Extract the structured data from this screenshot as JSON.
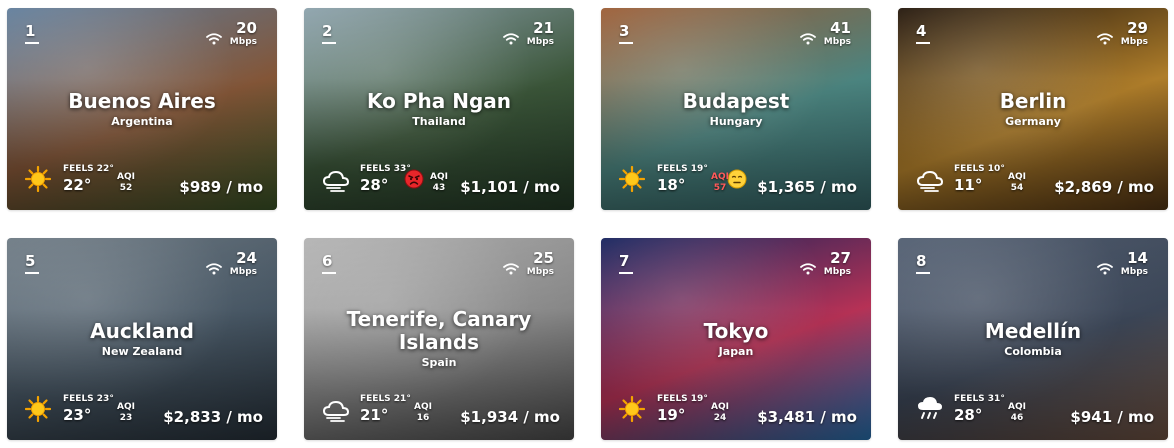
{
  "cards": [
    {
      "rank": "1",
      "city": "Buenos Aires",
      "country": "Argentina",
      "speed": "20",
      "unit": "Mbps",
      "feels": "FEELS 22°",
      "temp": "22°",
      "aqi_label": "AQI",
      "aqi": "52",
      "cost": "$989 / mo",
      "weather_icon": "sun-icon",
      "aqi_face": "",
      "aqi_color": "#ffffff",
      "photo_colors": [
        "#6f8fb0",
        "#8a5a3a",
        "#3f5b2a"
      ]
    },
    {
      "rank": "2",
      "city": "Ko Pha Ngan",
      "country": "Thailand",
      "speed": "21",
      "unit": "Mbps",
      "feels": "FEELS 33°",
      "temp": "28°",
      "aqi_label": "AQI",
      "aqi": "43",
      "cost": "$1,101 / mo",
      "weather_icon": "cloud-wind-icon",
      "aqi_face": "angry-face-icon",
      "aqi_color": "#ffffff",
      "photo_colors": [
        "#9fb7c2",
        "#3e5a3c",
        "#27402a"
      ]
    },
    {
      "rank": "3",
      "city": "Budapest",
      "country": "Hungary",
      "speed": "41",
      "unit": "Mbps",
      "feels": "FEELS 19°",
      "temp": "18°",
      "aqi_label": "AQI",
      "aqi": "57",
      "cost": "$1,365 / mo",
      "weather_icon": "sun-icon",
      "aqi_face": "neutral-face-icon",
      "aqi_color": "#ff5a5a",
      "photo_colors": [
        "#b06a3e",
        "#4f8b86",
        "#3a6f72"
      ]
    },
    {
      "rank": "4",
      "city": "Berlin",
      "country": "Germany",
      "speed": "29",
      "unit": "Mbps",
      "feels": "FEELS 10°",
      "temp": "11°",
      "aqi_label": "AQI",
      "aqi": "54",
      "cost": "$2,869 / mo",
      "weather_icon": "cloud-wind-icon",
      "aqi_face": "",
      "aqi_color": "#ffffff",
      "photo_colors": [
        "#2a1c10",
        "#b8842c",
        "#5a3a16"
      ]
    },
    {
      "rank": "5",
      "city": "Auckland",
      "country": "New Zealand",
      "speed": "24",
      "unit": "Mbps",
      "feels": "FEELS 23°",
      "temp": "23°",
      "aqi_label": "AQI",
      "aqi": "23",
      "cost": "$2,833 / mo",
      "weather_icon": "sun-icon",
      "aqi_face": "",
      "aqi_color": "#ffffff",
      "photo_colors": [
        "#7d8b96",
        "#4a5a68",
        "#2b3640"
      ]
    },
    {
      "rank": "6",
      "city": "Tenerife, Canary Islands",
      "country": "Spain",
      "speed": "25",
      "unit": "Mbps",
      "feels": "FEELS 21°",
      "temp": "21°",
      "aqi_label": "AQI",
      "aqi": "16",
      "cost": "$1,934 / mo",
      "weather_icon": "cloud-wind-icon",
      "aqi_face": "",
      "aqi_color": "#ffffff",
      "photo_colors": [
        "#c9c9c9",
        "#8f8f8f",
        "#555555"
      ]
    },
    {
      "rank": "7",
      "city": "Tokyo",
      "country": "Japan",
      "speed": "27",
      "unit": "Mbps",
      "feels": "FEELS 19°",
      "temp": "19°",
      "aqi_label": "AQI",
      "aqi": "24",
      "cost": "$3,481 / mo",
      "weather_icon": "sun-icon",
      "aqi_face": "",
      "aqi_color": "#ffffff",
      "photo_colors": [
        "#1b2a6a",
        "#c0345a",
        "#2a7cc0"
      ]
    },
    {
      "rank": "8",
      "city": "Medellín",
      "country": "Colombia",
      "speed": "14",
      "unit": "Mbps",
      "feels": "FEELS 31°",
      "temp": "28°",
      "aqi_label": "AQI",
      "aqi": "46",
      "cost": "$941 / mo",
      "weather_icon": "rain-cloud-icon",
      "aqi_face": "",
      "aqi_color": "#ffffff",
      "photo_colors": [
        "#5d6b80",
        "#3f4a5c",
        "#7a5a48"
      ]
    }
  ]
}
